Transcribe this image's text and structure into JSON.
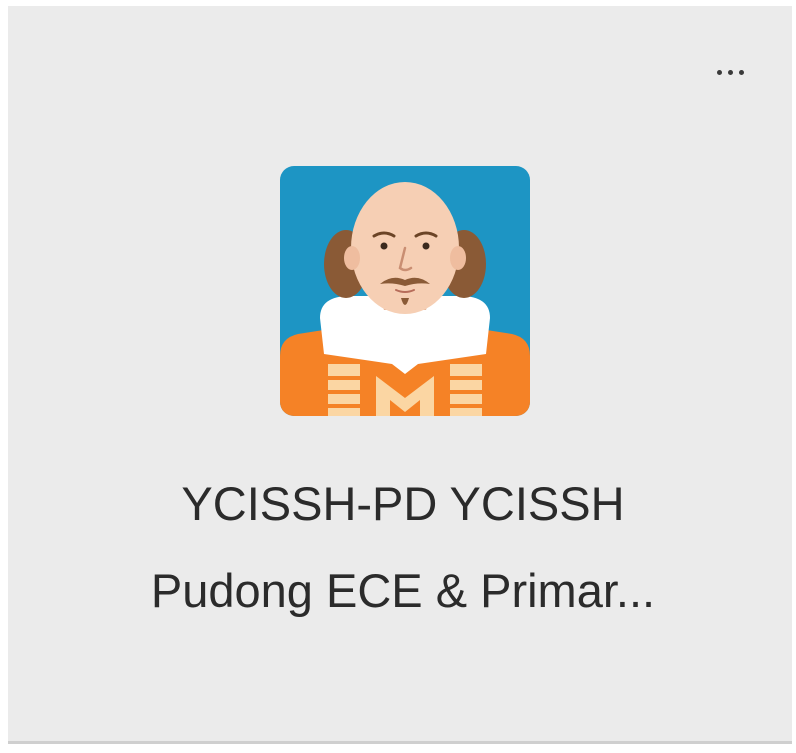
{
  "tile": {
    "more_icon": "more-horizontal-icon",
    "app_icon": "shakespeare-avatar-icon",
    "name_line1": "YCISSH-PD YCISSH",
    "name_line2": "Pudong ECE & Primar...",
    "colors": {
      "tile_background": "#ebebeb",
      "icon_sky": "#1d95c4",
      "icon_orange": "#f58226",
      "text": "#2b2b2b"
    }
  }
}
